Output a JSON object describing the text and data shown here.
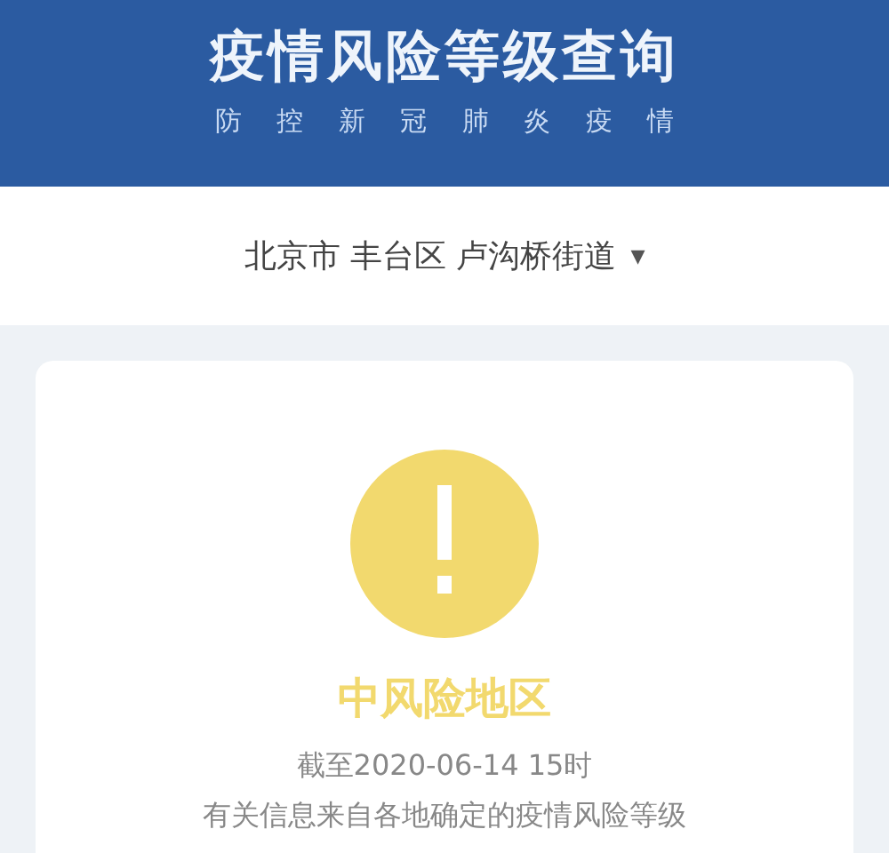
{
  "header": {
    "title": "疫情风险等级查询",
    "subtitle": "防 控 新 冠 肺 炎 疫 情"
  },
  "location": {
    "text": "北京市 丰台区 卢沟桥街道",
    "caret": "▾"
  },
  "result": {
    "level": "中风险地区",
    "color": "#f2d96e",
    "updated": "截至2020-06-14 15时",
    "note": "有关信息来自各地确定的疫情风险等级"
  }
}
